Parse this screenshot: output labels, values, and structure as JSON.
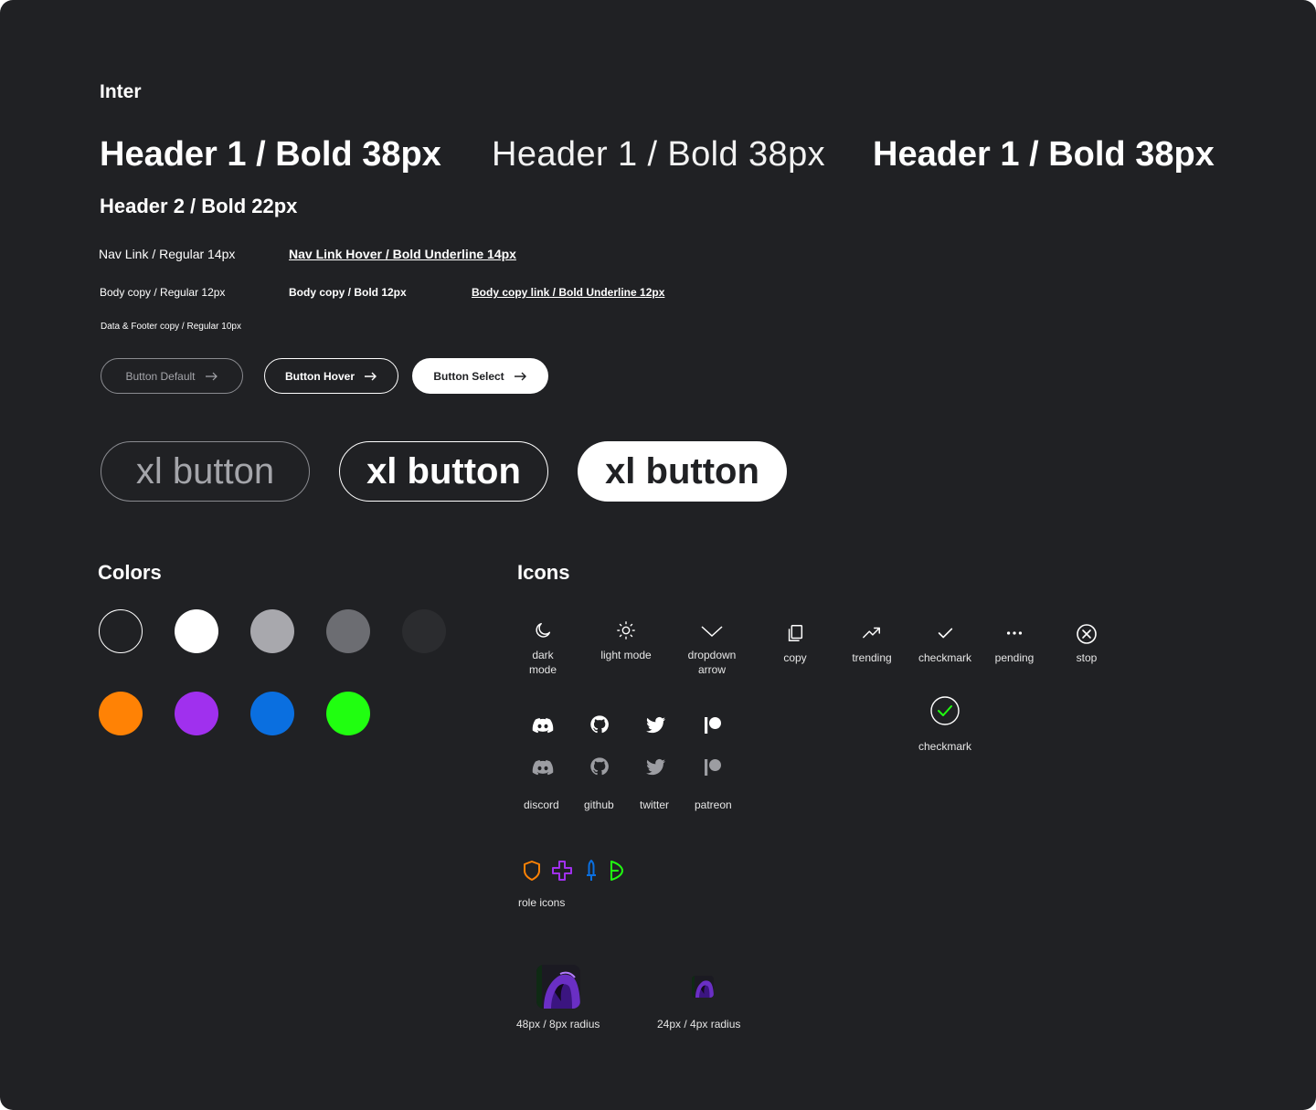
{
  "font_family_label": "Inter",
  "headers": {
    "h1": [
      "Header 1 / Bold 38px",
      "Header 1 / Bold 38px",
      "Header 1 / Bold 38px"
    ],
    "h2": "Header 2 / Bold 22px"
  },
  "text_styles": {
    "nav_link": "Nav Link / Regular 14px",
    "nav_link_hover": "Nav Link Hover / Bold Underline 14px",
    "body_copy": "Body copy / Regular 12px",
    "body_copy_bold": "Body copy / Bold 12px",
    "body_copy_link": "Body copy link / Bold Underline 12px",
    "data_footer": "Data & Footer copy / Regular 10px"
  },
  "buttons": {
    "default": "Button Default",
    "hover": "Button Hover",
    "select": "Button Select"
  },
  "xl_buttons": [
    "xl button",
    "xl button",
    "xl button"
  ],
  "colors": {
    "title": "Colors",
    "swatches": [
      "#202124",
      "#ffffff",
      "#a8a8ad",
      "#6c6d72",
      "#2b2c2f",
      "#ff8205",
      "#a030ee",
      "#0a6fe0",
      "#20ff10"
    ]
  },
  "icons": {
    "title": "Icons",
    "top_row": [
      {
        "name": "moon-icon",
        "label": "dark mode"
      },
      {
        "name": "sun-icon",
        "label": "light mode"
      },
      {
        "name": "chevron-down-icon",
        "label": "dropdown arrow"
      },
      {
        "name": "copy-icon",
        "label": "copy"
      },
      {
        "name": "trending-icon",
        "label": "trending"
      },
      {
        "name": "checkmark-icon",
        "label": "checkmark"
      },
      {
        "name": "more-horizontal-icon",
        "label": "pending"
      },
      {
        "name": "stop-icon",
        "label": "stop"
      }
    ],
    "checkmark_circle_label": "checkmark",
    "social": [
      {
        "name": "discord-icon",
        "label": "discord"
      },
      {
        "name": "github-icon",
        "label": "github"
      },
      {
        "name": "twitter-icon",
        "label": "twitter"
      },
      {
        "name": "patreon-icon",
        "label": "patreon"
      }
    ],
    "role_icons_label": "role icons",
    "role_colors": [
      "#ff8205",
      "#a030ee",
      "#0a6fe0",
      "#20ff10"
    ],
    "avatar_48_label": "48px / 8px radius",
    "avatar_24_label": "24px / 4px radius"
  }
}
